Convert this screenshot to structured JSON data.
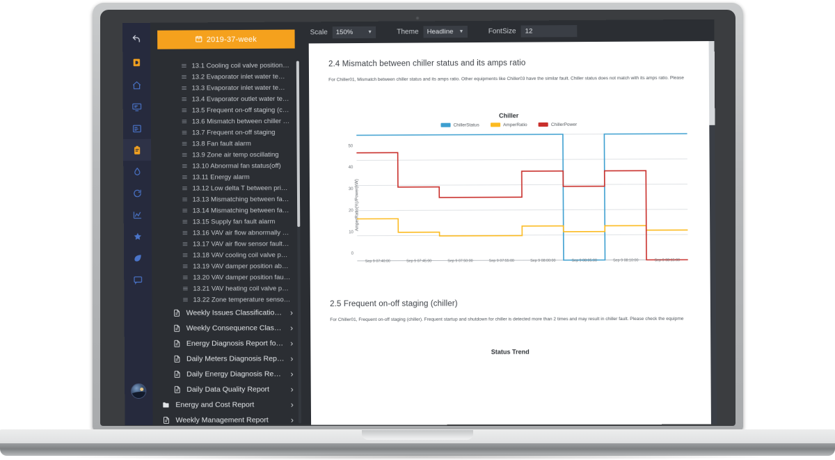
{
  "app": {
    "rail": {
      "items": [
        {
          "name": "back-icon",
          "label": "Back"
        },
        {
          "name": "brand-logo-icon",
          "label": "D"
        },
        {
          "name": "home-icon",
          "label": "Home"
        },
        {
          "name": "monitor-icon",
          "label": "Monitoring"
        },
        {
          "name": "document-icon",
          "label": "Documents"
        },
        {
          "name": "clipboard-icon",
          "label": "Reports"
        },
        {
          "name": "droplet-icon",
          "label": "Water"
        },
        {
          "name": "refresh-icon",
          "label": "Refresh"
        },
        {
          "name": "chart-icon",
          "label": "Analytics"
        },
        {
          "name": "star-icon",
          "label": "Favorites"
        },
        {
          "name": "leaf-icon",
          "label": "Energy"
        },
        {
          "name": "chat-icon",
          "label": "Messages"
        }
      ]
    },
    "sidebar": {
      "week_button": "2019-37-week",
      "leaf_items": [
        "13.1 Cooling coil valve position rea...",
        "13.2 Evaporator inlet water temper...",
        "13.3 Evaporator inlet water temper...",
        "13.4 Evaporator outlet water tempe...",
        "13.5 Frequent on-off staging (chiller)",
        "13.6 Mismatch between chiller stat...",
        "13.7 Frequent on-off staging",
        "13.8 Fan fault alarm",
        "13.9 Zone air temp oscillating",
        "13.10 Abnormal fan status(off)",
        "13.11 Energy alarm",
        "13.12 Low delta T between primary...",
        "13.13 Mismatching between fan an...",
        "13.14 Mismatching between fan po...",
        "13.15 Supply fan fault alarm",
        "13.16 VAV air flow abnormally oscil...",
        "13.17 VAV air flow sensor fault with...",
        "13.18 VAV cooling coil valve positio...",
        "13.19 VAV damper position abnor...",
        "13.20 VAV damper position fault wi...",
        "13.21 VAV heating coil valve positi...",
        "13.22 Zone temperature sensor fa..."
      ],
      "doc_items": [
        {
          "label": "Weekly Issues Classification ...",
          "icon": "file-icon",
          "level": 1,
          "chevron": "›"
        },
        {
          "label": "Weekly Consequence Classi...",
          "icon": "file-icon",
          "level": 1,
          "chevron": "›"
        },
        {
          "label": "Energy Diagnosis Report for ...",
          "icon": "file-icon",
          "level": 1,
          "chevron": "›"
        },
        {
          "label": "Daily Meters Diagnosis Report",
          "icon": "file-icon",
          "level": 1,
          "chevron": "›"
        },
        {
          "label": "Daily Energy Diagnosis Report",
          "icon": "file-icon",
          "level": 1,
          "chevron": "›"
        },
        {
          "label": "Daily Data Quality Report",
          "icon": "file-icon",
          "level": 1,
          "chevron": "›"
        },
        {
          "label": "Energy and Cost Report",
          "icon": "folder-icon",
          "level": 0,
          "chevron": "›"
        },
        {
          "label": "Weekly Management Report",
          "icon": "file-icon",
          "level": 0,
          "chevron": "›"
        }
      ]
    },
    "toolbar": {
      "scale_label": "Scale",
      "scale_value": "150%",
      "theme_label": "Theme",
      "theme_value": "Headline",
      "fontsize_label": "FontSize",
      "fontsize_value": "12"
    },
    "document": {
      "section_24_heading": "2.4 Mismatch between chiller status and its amps ratio",
      "section_24_body": "For Chiller01, Mismatch between chiller status and its amps ratio. Other equipments like Chiller03 have the similar fault. Chiller status does not match with its amps ratio. Please",
      "section_25_heading": "2.5 Frequent on-off staging (chiller)",
      "section_25_body": "For Chiller01, Frequent on-off staging (chiller). Frequent startup and shutdown for chiller is detected more than 2 times and may result in chiller fault. Please check the equipme",
      "trend_title": "Status Trend"
    }
  },
  "colors": {
    "brand_orange": "#f5a11d",
    "rail_bg": "#262a3d",
    "sidebar_bg": "#2b2e33",
    "chiller_status": "#3d9fd0",
    "amper_ratio": "#fcbb21",
    "chiller_power": "#c9302c"
  },
  "chart_data": {
    "type": "line",
    "title": "Chiller",
    "xlabel": "",
    "ylabel": "AmperRatio(%)/Power(kW)",
    "ylim": [
      0,
      50
    ],
    "yticks": [
      0,
      10,
      20,
      30,
      40,
      50
    ],
    "grid": true,
    "legend_position": "top",
    "interpolation": "step",
    "categories": [
      "Sep 9 07:40:00",
      "Sep 9 07:45:00",
      "Sep 9 07:50:00",
      "Sep 9 07:55:00",
      "Sep 9 08:00:00",
      "Sep 9 08:05:00",
      "Sep 9 08:10:00",
      "Sep 9 08:15:00"
    ],
    "series": [
      {
        "name": "ChillerStatus",
        "color": "#3d9fd0",
        "values": [
          50,
          50,
          50,
          50,
          50,
          0,
          50,
          50
        ]
      },
      {
        "name": "AmperRatio",
        "color": "#fcbb21",
        "values": [
          16.7,
          11.3,
          9.8,
          9.8,
          13.6,
          11.3,
          13.6,
          11.8
        ]
      },
      {
        "name": "ChillerPower",
        "color": "#c9302c",
        "values": [
          43.0,
          29.3,
          25.1,
          25.1,
          35.4,
          29.3,
          35.4,
          0
        ]
      }
    ]
  }
}
